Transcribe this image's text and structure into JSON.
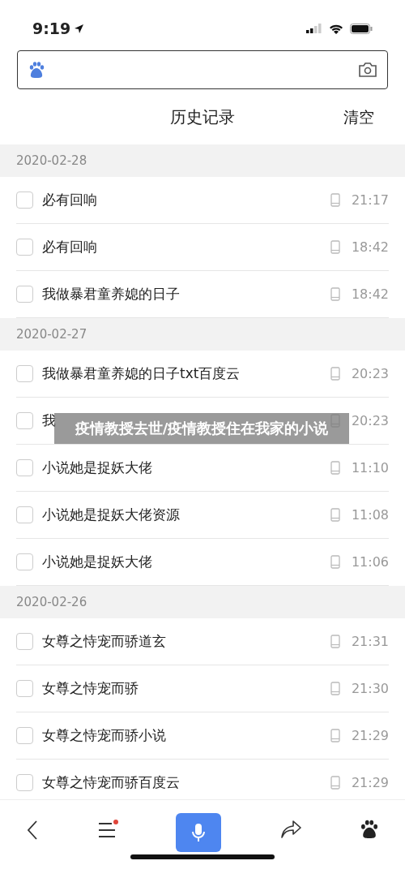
{
  "status_bar": {
    "time": "9:19"
  },
  "header": {
    "title": "历史记录",
    "action": "清空"
  },
  "sections": [
    {
      "date": "2020-02-28",
      "items": [
        {
          "text": "必有回响",
          "time": "21:17",
          "checked": false
        },
        {
          "text": "必有回响",
          "time": "18:42",
          "checked": false
        },
        {
          "text": "我做暴君童养媳的日子",
          "time": "18:42",
          "checked": false
        }
      ]
    },
    {
      "date": "2020-02-27",
      "items": [
        {
          "text": "我做暴君童养媳的日子txt百度云",
          "time": "20:23",
          "checked": false
        },
        {
          "text": "我",
          "time": "20:23",
          "checked": false
        },
        {
          "text": "小说她是捉妖大佬",
          "time": "11:10",
          "checked": false
        },
        {
          "text": "小说她是捉妖大佬资源",
          "time": "11:08",
          "checked": false
        },
        {
          "text": "小说她是捉妖大佬",
          "time": "11:06",
          "checked": false
        }
      ]
    },
    {
      "date": "2020-02-26",
      "items": [
        {
          "text": "女尊之恃宠而骄道玄",
          "time": "21:31",
          "checked": false
        },
        {
          "text": "女尊之恃宠而骄",
          "time": "21:30",
          "checked": false
        },
        {
          "text": "女尊之恃宠而骄小说",
          "time": "21:29",
          "checked": false
        },
        {
          "text": "女尊之恃宠而骄百度云",
          "time": "21:29",
          "checked": false
        }
      ]
    }
  ],
  "overlay_caption": "疫情教授去世/疫情教授住在我家的小说",
  "toolbar": {
    "menu_notification": true
  }
}
